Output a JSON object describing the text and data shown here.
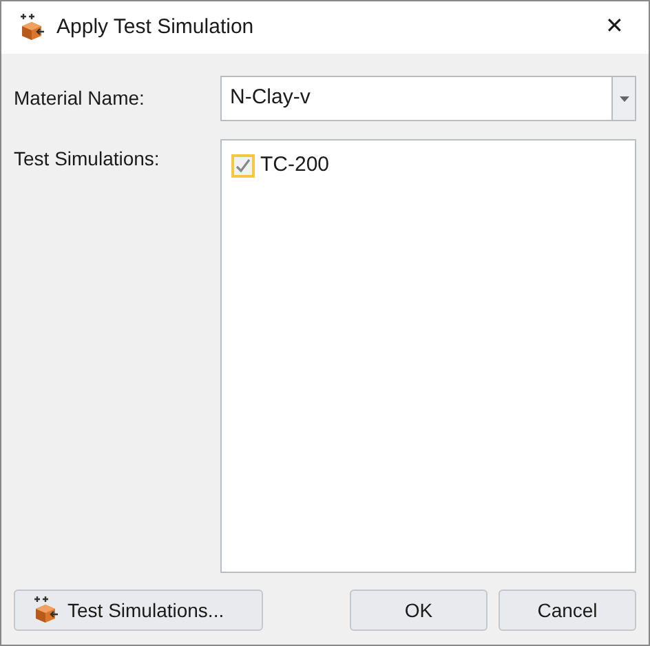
{
  "window": {
    "title": "Apply Test Simulation",
    "close": "✕"
  },
  "material": {
    "label": "Material Name:",
    "value": "N-Clay-v"
  },
  "simulations": {
    "label": "Test Simulations:",
    "items": [
      {
        "name": "TC-200",
        "checked": true
      }
    ]
  },
  "buttons": {
    "manage": "Test Simulations...",
    "ok": "OK",
    "cancel": "Cancel"
  }
}
